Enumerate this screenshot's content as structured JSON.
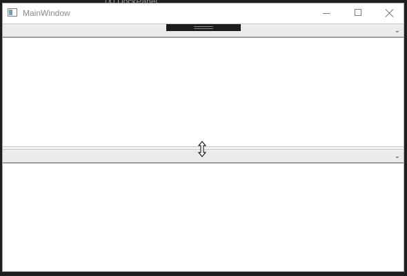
{
  "window": {
    "title": "MainWindow"
  },
  "background": {
    "partial_text": "[X] DockPanel"
  },
  "panels": {
    "top": {
      "collapse_icon": "chevron-down-icon"
    },
    "bottom": {
      "collapse_icon": "chevron-down-icon"
    }
  },
  "icons": {
    "minimize": "minimize-icon",
    "maximize": "maximize-icon",
    "close": "close-icon",
    "cursor": "resize-vertical-cursor-icon"
  },
  "colors": {
    "header_bg": "#ebebeb",
    "handle": "#1c1c1c",
    "window_bg": "#ffffff"
  }
}
